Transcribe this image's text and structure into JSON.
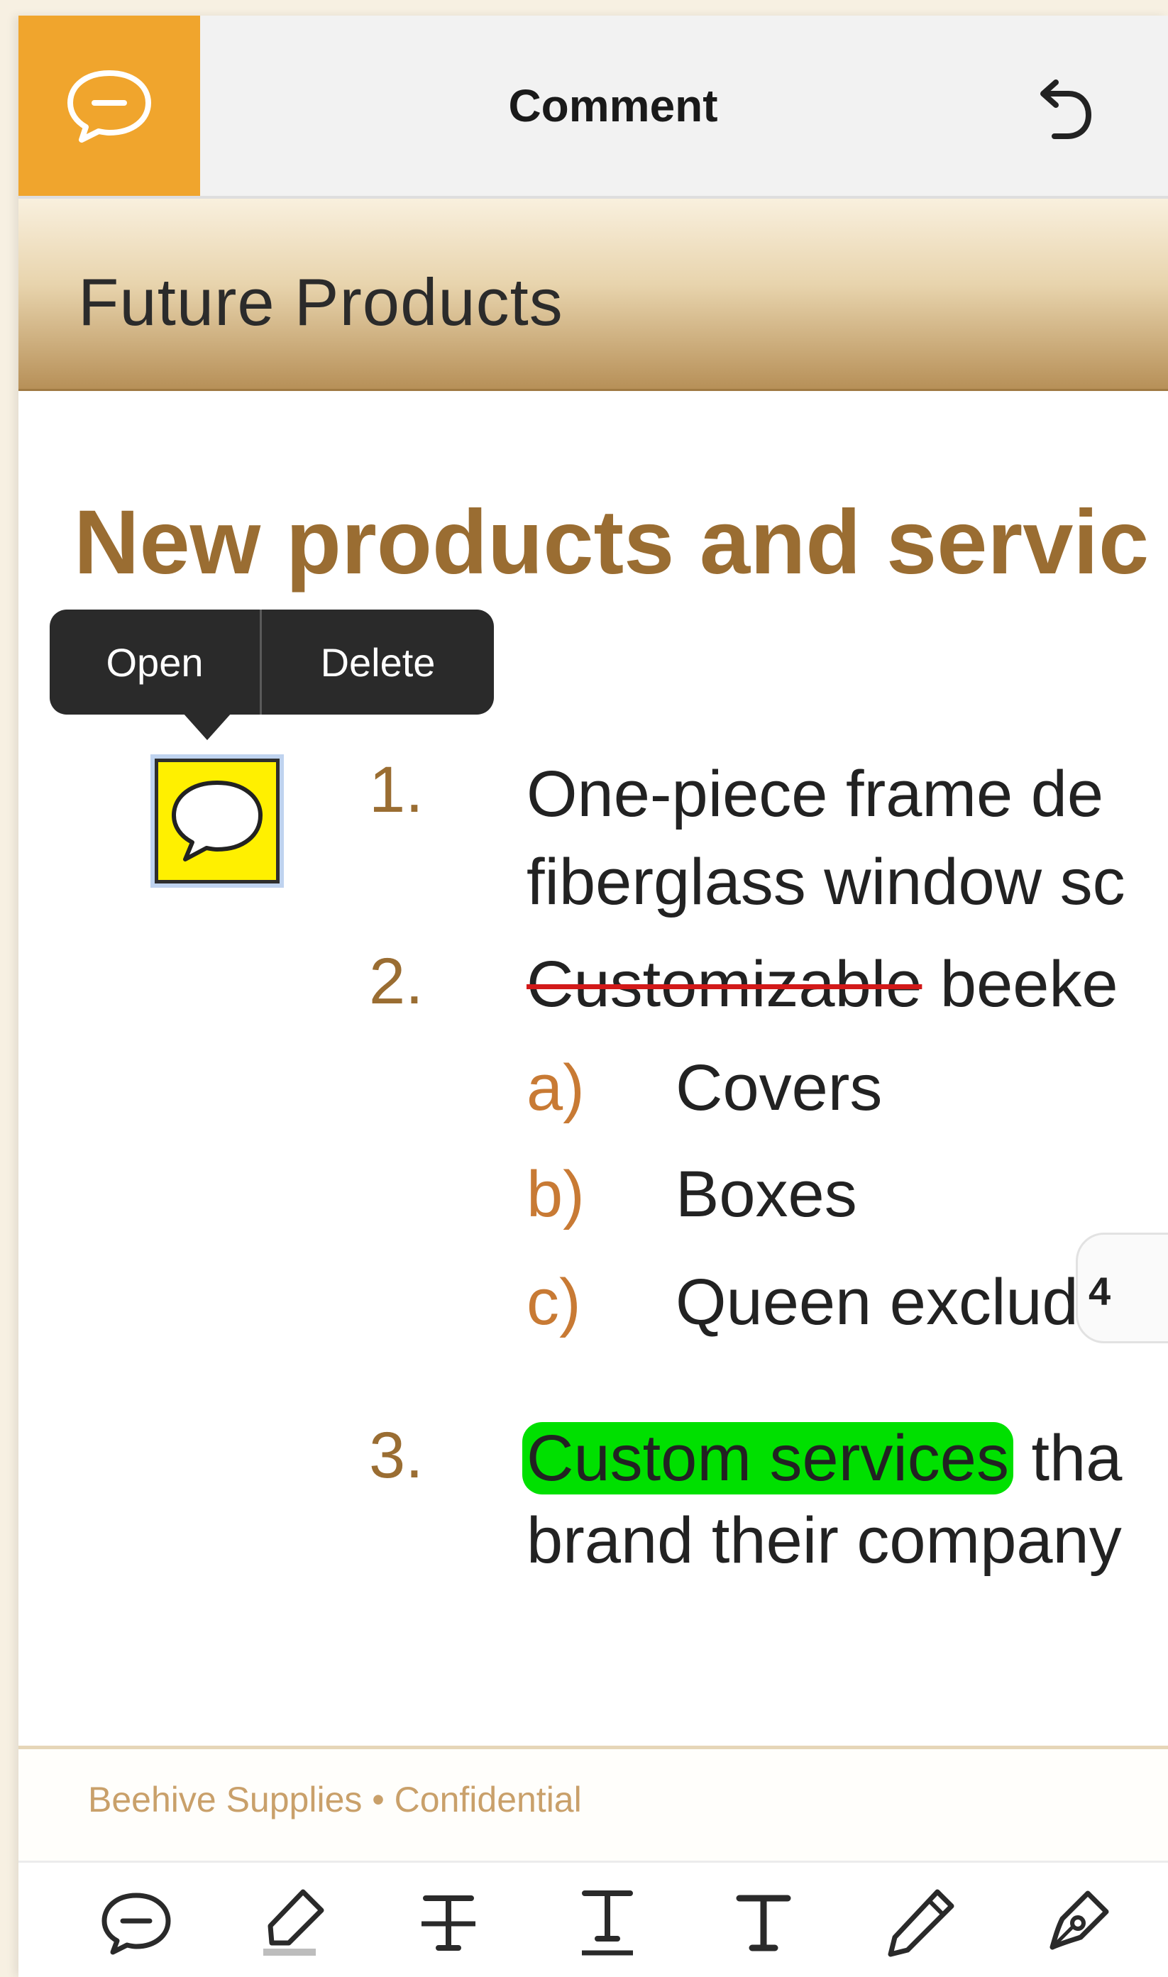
{
  "header": {
    "mode_icon": "comment-bubble-icon",
    "title": "Comment",
    "undo_icon": "undo-icon"
  },
  "section": {
    "title": "Future Products"
  },
  "document": {
    "heading": "New products and servic",
    "popup": {
      "open_label": "Open",
      "delete_label": "Delete"
    },
    "annotation_icon": "sticky-note-comment-icon",
    "items": [
      {
        "number": "1.",
        "line1": "One-piece frame de",
        "line2": "fiberglass window sc"
      },
      {
        "number": "2.",
        "struck": "Customizable",
        "rest": " beeke"
      },
      {
        "number": "3.",
        "highlighted": "Custom services",
        "rest": " tha",
        "line2": "brand their company"
      }
    ],
    "subitems": [
      {
        "letter": "a)",
        "text": "Covers"
      },
      {
        "letter": "b)",
        "text": "Boxes"
      },
      {
        "letter": "c)",
        "text": "Queen exclude"
      }
    ],
    "page_indicator": "4"
  },
  "footer": {
    "text": "Beehive Supplies  •  Confidential"
  },
  "toolbar": {
    "tools": [
      "comment-icon",
      "highlighter-icon",
      "strikethrough-icon",
      "underline-icon",
      "text-icon",
      "pencil-icon",
      "signature-pen-icon"
    ]
  },
  "colors": {
    "accent": "#f0a52d",
    "heading": "#9a6d32",
    "highlight": "#00e000",
    "strike": "#d21919",
    "note": "#fff000"
  }
}
